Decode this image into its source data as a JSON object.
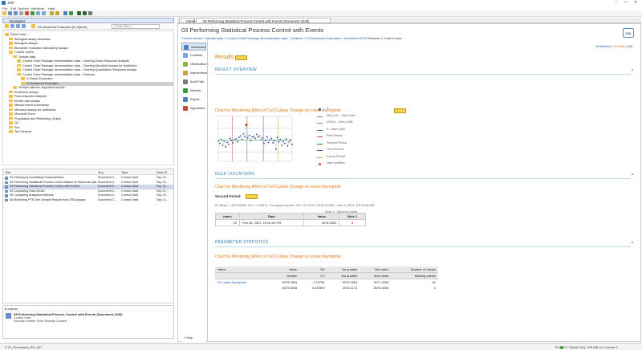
{
  "window": {
    "title": "JMP",
    "controls": [
      "–",
      "□",
      "✕"
    ]
  },
  "menu": [
    "File",
    "Edit",
    "Options",
    "Validation",
    "Help"
  ],
  "navigator": {
    "tab_label": "Navigator",
    "path": "03 Advanced Examples (8 objects)",
    "filter_placeholder": "<Enter filter>",
    "tree": [
      {
        "label": "Root Folder",
        "indent": 0,
        "kind": "folder"
      },
      {
        "label": "Biological assay simulation",
        "indent": 1,
        "kind": "folder"
      },
      {
        "label": "Biological assays",
        "indent": 1,
        "kind": "folder"
      },
      {
        "label": "Biomarker evaluation laboratory assays",
        "indent": 1,
        "kind": "folder"
      },
      {
        "label": "Control charts",
        "indent": 1,
        "kind": "folder"
      },
      {
        "label": "Sample data",
        "indent": 2,
        "kind": "folder"
      },
      {
        "label": "Control Chart Package demonstration data - Charting Dose-Response Analysis",
        "indent": 3,
        "kind": "folder"
      },
      {
        "label": "Control Chart Package demonstration data - Charting Microbial Assays for Antibiotics",
        "indent": 3,
        "kind": "folder"
      },
      {
        "label": "Control Chart Package demonstration data - Charting Quantitative Response Assays",
        "indent": 3,
        "kind": "folder"
      },
      {
        "label": "Control Chart Package demonstration data - Features",
        "indent": 3,
        "kind": "folder"
      },
      {
        "label": "01 Basic Examples",
        "indent": 4,
        "kind": "folder"
      },
      {
        "label": "03 Advanced Examples",
        "indent": 4,
        "kind": "folder",
        "selected": true
      },
      {
        "label": "Sample data for supported reports",
        "indent": 2,
        "kind": "folder"
      },
      {
        "label": "Endotoxin assays",
        "indent": 1,
        "kind": "folder"
      },
      {
        "label": "Flow-response analysis",
        "indent": 1,
        "kind": "folder"
      },
      {
        "label": "Kinetic rate assays",
        "indent": 1,
        "kind": "folder"
      },
      {
        "label": "Measurement uncertainty",
        "indent": 1,
        "kind": "folder"
      },
      {
        "label": "Microbial assays for antibiotics",
        "indent": 1,
        "kind": "folder"
      },
      {
        "label": "Microsoft Excel",
        "indent": 1,
        "kind": "folder"
      },
      {
        "label": "Propitiation and Reflecting: (Unite)",
        "indent": 1,
        "kind": "folder"
      },
      {
        "label": "QC",
        "indent": 1,
        "kind": "folder"
      },
      {
        "label": "Rex",
        "indent": 1,
        "kind": "folder"
      },
      {
        "label": "Test Reports",
        "indent": 1,
        "kind": "folder"
      }
    ]
  },
  "objects": {
    "headers": [
      "Title",
      "Key",
      "Type",
      "Date M"
    ],
    "rows": [
      [
        "01 Defining by Annotating Characteristics",
        "Document 3...",
        "Control chart",
        "Sep 22,..."
      ],
      [
        "02 Performing Statistical Process Control Based on Historical Data",
        "Document 2...",
        "Control chart",
        "Sep 22,..."
      ],
      [
        "03 Performing Statistical Process Control with Events",
        "Document 2...",
        "Control chart",
        "Sep 22,..."
      ],
      [
        "04 Comparing Data Series",
        "Document 2...",
        "Control chart",
        "Sep 22,..."
      ],
      [
        "05 Comparing Analytical Methods",
        "Document 2...",
        "Control chart",
        "Sep 22,..."
      ],
      [
        "06 Monitoring PTB Unit Sample Results from ERA Assays",
        "Document 2...",
        "Control chart",
        "Sep 22,..."
      ]
    ],
    "selected_index": 2
  },
  "info": {
    "count": "8 objects",
    "title": "03 Performing Statistical Process Control with Events (Document 2230)",
    "type": "Control chart",
    "security": "Security context: Root Security Context"
  },
  "editor": {
    "tabs": [
      "Home",
      "03 Performing Statistical Process Control with Events (Document 2230)"
    ],
    "title": "03 Performing Statistical Process Control with Events",
    "breadcrumb": [
      "Control charts",
      "Sample data",
      "Control Chart Package demonstration data - Features",
      "03 Advanced Examples",
      "Document 2230"
    ],
    "breadcrumb_current": "Revision 1 Control chart",
    "logo": "CHK",
    "sidenav": [
      {
        "label": "Dashboard",
        "active": true,
        "color": "#4a7fc1"
      },
      {
        "label": "Contents",
        "color": "#7aa7d9"
      },
      {
        "label": "Observations",
        "color": "#8fb54a"
      },
      {
        "label": "Interventions",
        "color": "#c7a33a"
      },
      {
        "label": "Audit Trail",
        "color": "#7a7a7a"
      },
      {
        "label": "Refresh",
        "color": "#3a9a3a"
      },
      {
        "label": "Report...",
        "color": "#4a7fc1"
      },
      {
        "label": "Signatures...",
        "color": "#c44a3a"
      }
    ],
    "help": "Help",
    "top_links": {
      "definitions": "Definitions",
      "results": "Results",
      "edit": "Edit",
      "sep": "|"
    },
    "results_title": "Results",
    "result_overview": "RESULT OVERVIEW",
    "chart_title": "Chart for Monitoring Effect of Cell Culture Change on Lower Asymptote",
    "legend": [
      "X",
      "UCL/LCL - New Cells",
      "2SUCL - New Cells",
      "X̄ - New Cells",
      "First Period",
      "Second Period",
      "Third Period",
      "Fourth Period",
      "New violation"
    ],
    "rule_violations": "RULE VIOLATIONS",
    "rv_chart_title": "Chart for Monitoring Effect of Cell Culture Change on Lower Asymptote",
    "second_period": "Second Period",
    "rv_stats": "Ø. Mean = 3075.5585, SD = 1.08471, Grouping interval: Feb 13, 2021, 03:00:13 AM - Mar 5, 2021, 03:33:06 AM",
    "rv_rulelbl": "Rule 1 - Beyond Limits",
    "rv_table": {
      "headers": [
        "Index",
        "Date",
        "Value",
        "Rule 1"
      ],
      "rows": [
        [
          "20",
          "Feb 26, 2021, 12:00:00 PM",
          "3078.3253",
          "●"
        ]
      ]
    },
    "param_stats": "PARAMETER STATISTICS",
    "ps_chart_title": "Chart for Monitoring Effect of Cell Culture Change on Lower Asymptote",
    "ps_table": {
      "headers1": [
        "Name",
        "Mean",
        "SD",
        "1st quartile",
        "Min value",
        "Number of values"
      ],
      "headers2": [
        "",
        "Median",
        "CV",
        "3rd quartile",
        "Max value",
        "Missing values"
      ],
      "row1": [
        "03 Lower Asymptote",
        "3075.2954",
        "1.13766",
        "3075.0904",
        "3071.3236",
        "51"
      ],
      "row2": [
        "",
        "3075.3046",
        "0.0396%",
        "3076.1173",
        "3078.3253",
        "0"
      ]
    }
  },
  "status": {
    "left": "C:\\S_Permanent_R\\1_W7",
    "right": "PLA 5.0.7 (Build 104), 376 MB 1x, License 1"
  },
  "chart_data": {
    "type": "scatter",
    "x": [
      1,
      2,
      3,
      4,
      5,
      6,
      7,
      8,
      9,
      10,
      11,
      12,
      13,
      14,
      15,
      16,
      17,
      18,
      19,
      20,
      21,
      22,
      23,
      24,
      25,
      26,
      27,
      28,
      29,
      30,
      31,
      32,
      33,
      34,
      35,
      36,
      37,
      38,
      39,
      40,
      41,
      42,
      43,
      44,
      45,
      46,
      47,
      48,
      49,
      50,
      51
    ],
    "series": [
      {
        "name": "X",
        "values": [
          3075.1,
          3074.6,
          3075.4,
          3074.2,
          3075.0,
          3073.9,
          3074.8,
          3074.4,
          3075.6,
          3075.2,
          3074.7,
          3075.3,
          3075.5,
          3074.9,
          3075.8,
          3076.1,
          3075.4,
          3076.5,
          3075.9,
          3078.3,
          3075.7,
          3076.2,
          3075.1,
          3075.9,
          3076.0,
          3075.6,
          3076.4,
          3075.8,
          3076.1,
          3075.3,
          3075.7,
          3074.6,
          3075.2,
          3075.9,
          3074.8,
          3075.3,
          3075.6,
          3074.7,
          3075.1,
          3073.4,
          3075.8,
          3074.9,
          3075.4,
          3074.2,
          3075.0,
          3074.6,
          3075.5,
          3074.1,
          3074.9,
          3075.3,
          3074.4
        ]
      }
    ],
    "ucl": 3077.6,
    "lcl": 3072.9,
    "center": 3075.3,
    "period_bounds": [
      10,
      20,
      31,
      41
    ],
    "violation_index": 20,
    "xlabel": "",
    "ylabel": "",
    "ylim": [
      3071,
      3080
    ],
    "colors": {
      "points": "#2a4fa0",
      "limits": "#5a8fd0",
      "center": "#2e8b3a",
      "period1": "#c44a3a",
      "period2": "#3a7a3a",
      "period3": "#7a3aa0",
      "period4": "#c7a33a",
      "violation": "#d03020"
    }
  }
}
